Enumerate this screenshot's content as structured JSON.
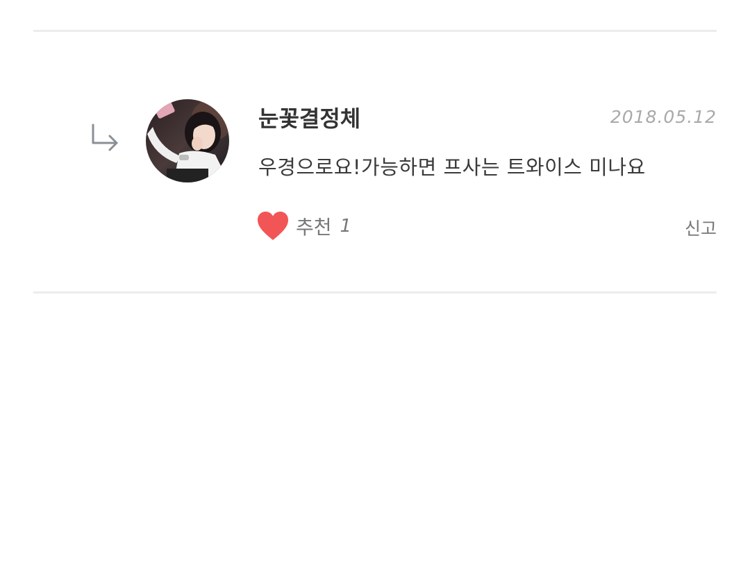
{
  "comment": {
    "author": "눈꽃결정체",
    "date": "2018.05.12",
    "text": "우경으로요!가능하면 프사는 트와이스 미나요",
    "like_label": "추천",
    "like_count": "1",
    "report_label": "신고"
  },
  "icons": {
    "reply": "reply-arrow-icon",
    "like": "heart-icon"
  },
  "colors": {
    "heart": "#f25555",
    "reply_arrow": "#8a8f96",
    "date": "#a9a9a9",
    "divider": "#ececec"
  }
}
